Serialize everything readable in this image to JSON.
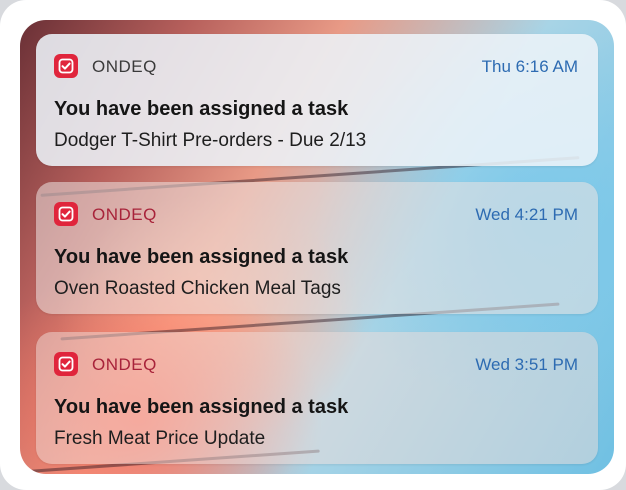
{
  "notifications": [
    {
      "app_icon": "checkmark-icon",
      "app_name": "ONDEQ",
      "time": "Thu 6:16 AM",
      "title": "You have been assigned a task",
      "body": "Dodger T-Shirt Pre-orders - Due 2/13"
    },
    {
      "app_icon": "checkmark-icon",
      "app_name": "ONDEQ",
      "time": "Wed 4:21 PM",
      "title": "You have been assigned a task",
      "body": "Oven Roasted Chicken Meal Tags"
    },
    {
      "app_icon": "checkmark-icon",
      "app_name": "ONDEQ",
      "time": "Wed 3:51 PM",
      "title": "You have been assigned a task",
      "body": "Fresh Meat Price Update"
    }
  ],
  "colors": {
    "app_icon_bg": "#e0253c",
    "timestamp": "#2d6bb2"
  }
}
